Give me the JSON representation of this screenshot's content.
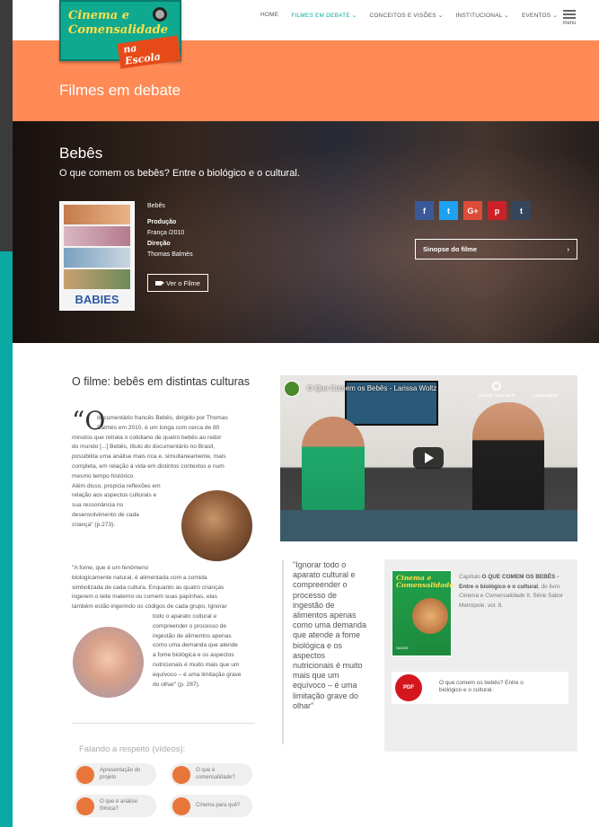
{
  "header": {
    "logo_line1": "Cinema e",
    "logo_line2": "Comensalidade",
    "logo_line3": "na Escola",
    "nav": [
      "HOME",
      "FILMES EM DEBATE ⌄",
      "CONCEITOS E VISÕES ⌄",
      "INSTITUCIONAL ⌄",
      "EVENTOS ⌄"
    ],
    "menu_label": "menu"
  },
  "band": {
    "title": "Filmes em debate"
  },
  "hero": {
    "title": "Bebês",
    "subtitle": "O que comem os bebês? Entre o biológico e o cultural.",
    "poster_title": "BABIES",
    "film_name": "Bebês",
    "production_label": "Produção",
    "production_value": "França /2010",
    "direction_label": "Direção",
    "direction_value": "Thomas Balmès",
    "watch_label": "Ver o Filme",
    "social": [
      "f",
      "t",
      "G+",
      "p",
      "t"
    ],
    "synopsis_label": "Sinopse do filme",
    "synopsis_arrow": "›"
  },
  "article": {
    "title": "O filme: bebês em distintas culturas",
    "quote_mark": "“O",
    "p1_lines": [
      "documentário francês Bebês, dirigido por Thomas",
      "Balmès em 2010, é um longa com cerca de 80",
      "minutos que retrata o cotidiano de quatro bebês ao redor",
      "do mundo [...] Bebês, título do documentário no Brasil,",
      "possibilita uma análise mais rica e, simultaneamente, mais",
      "completa, em relação à vida em distintos contextos e num",
      "mesmo tempo histórico.",
      "Além disso, propicia reflexões em",
      "relação aos aspectos culturais e",
      "sua ressonância no",
      "desenvolvimento de cada",
      "criança\" (p.273)."
    ],
    "p2_lines": [
      "\"A fome, que é um fenômeno",
      "biologicamente natural, é alimentada com a comida",
      "simbolizada de cada cultura. Enquanto as quatro crianças",
      "ingerem o leite materno ou comem suas papinhas, elas",
      "também estão ingerindo os códigos de cada grupo. Ignorar",
      "todo o aparato cultural e",
      "compreender o processo de",
      "ingestão de alimentos apenas",
      "como uma demanda que atende",
      "a fome biológica e os aspectos",
      "nutricionais é muito mais que um",
      "equívoco – é uma limitação grave",
      "do olhar\" (p. 287)."
    ]
  },
  "talks": {
    "title": "Falando a respeito (vídeos):",
    "items": [
      {
        "label": "Apresentação do projeto"
      },
      {
        "label": "O que é comensalidade?"
      },
      {
        "label": "O que é análise fílmica?"
      },
      {
        "label": "Cinema para quê?"
      }
    ]
  },
  "video": {
    "title": "O Que Comem os Bebês - Larissa Woltz",
    "watch_later": "Assistir mais tarde",
    "share": "Compartilhar"
  },
  "pullquote": "\"Ignorar todo o aparato cultural e compreender o processo de ingestão de alimentos apenas como uma demanda que atende a fome biológica e os aspectos nutricionais é muito mais que um equívoco – é uma limitação grave do olhar\"",
  "book": {
    "cover_title": "Cinema e Comensalidade",
    "cover_bottom": "SAÚDE",
    "caption_pre": "Capítulo ",
    "caption_bold": "O QUE COMEM OS BEBÊS - Entre o biológico e o cultural",
    "caption_mid": ", do livro ",
    "caption_italic": "Cinema e Comensalidade",
    "caption_end": " II. Série Sabor Metrópole, vol. 8.",
    "pdf_icon": "PDF",
    "pdf_label": "O que comem os bebês? Entre o biológico e o cultural."
  },
  "colors": {
    "teal": "#0aa9a3",
    "orange": "#ff8a55",
    "facebook": "#3b5998",
    "twitter": "#1da1f2",
    "googleplus": "#dd4b39",
    "pinterest": "#cb2027",
    "tumblr": "#35465c",
    "pdf_red": "#d4171e"
  }
}
